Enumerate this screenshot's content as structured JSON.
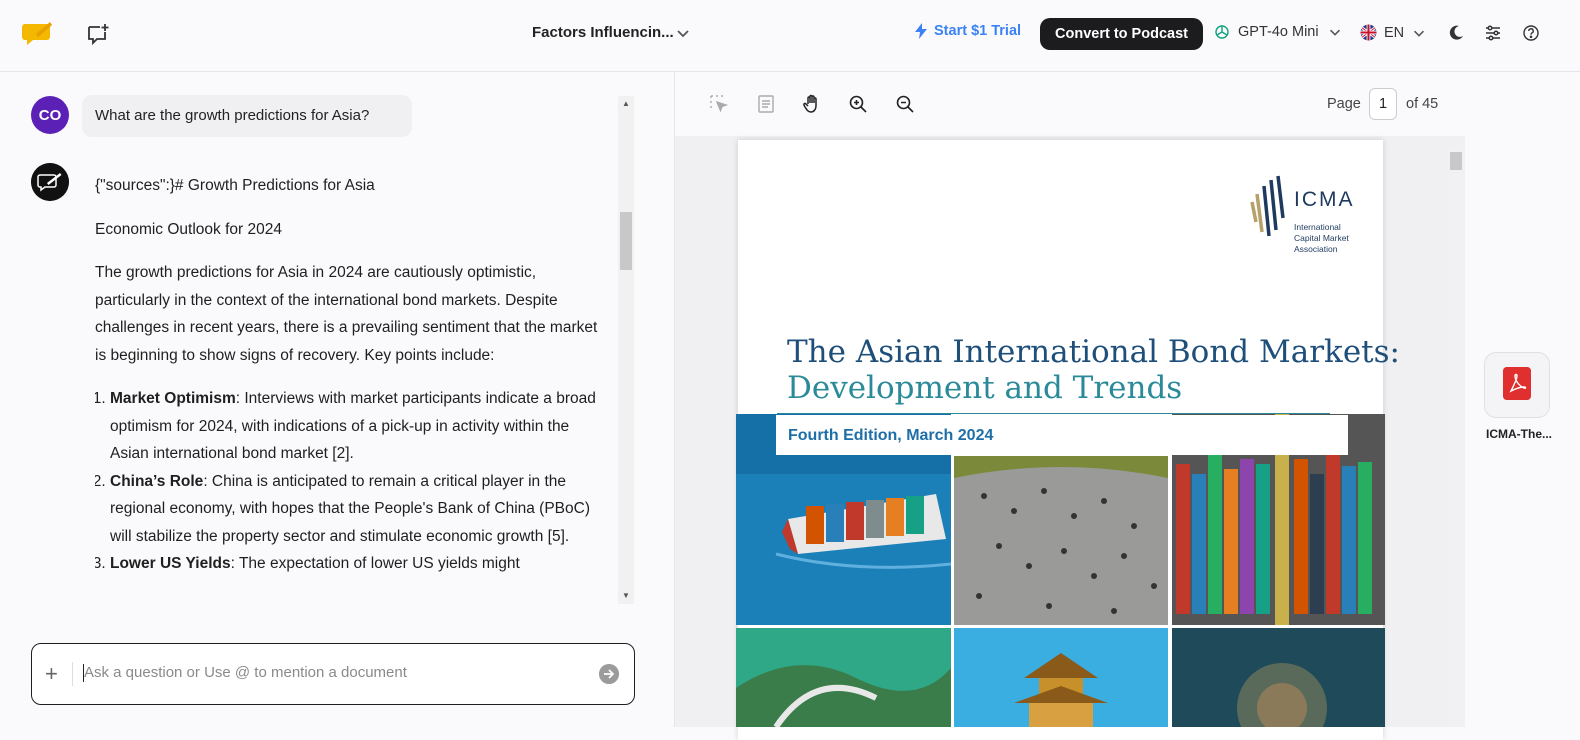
{
  "header": {
    "doc_title": "Factors Influencin...",
    "trial_label": "Start $1 Trial",
    "podcast_label": "Convert to Podcast",
    "model_label": "GPT-4o Mini",
    "lang_label": "EN"
  },
  "chat": {
    "user_initials": "CO",
    "user_question": "What are the growth predictions for Asia?",
    "answer_heading": "{\"sources\":}# Growth Predictions for Asia",
    "answer_subheading": "Economic Outlook for 2024",
    "answer_intro": "The growth predictions for Asia in 2024 are cautiously optimistic, particularly in the context of the international bond markets. Despite challenges in recent years, there is a prevailing sentiment that the market is beginning to show signs of recovery. Key points include:",
    "points": [
      {
        "title": "Market Optimism",
        "text": ": Interviews with market participants indicate a broad optimism for 2024, with indications of a pick-up in activity within the Asian international bond market [2]."
      },
      {
        "title": "China’s Role",
        "text": ": China is anticipated to remain a critical player in the regional economy, with hopes that the People's Bank of China (PBoC) will stabilize the property sector and stimulate economic growth [5]."
      },
      {
        "title": "Lower US Yields",
        "text": ": The expectation of lower US yields might"
      }
    ],
    "input_placeholder": "Ask a question or Use @ to mention a document"
  },
  "viewer": {
    "page_label": "Page",
    "page_current": "1",
    "page_total_label": "of 45"
  },
  "pdf": {
    "org_name": "ICMA",
    "org_sub": "International Capital Market Association",
    "title_line1": "The Asian International Bond Markets:",
    "title_line2": "Development and Trends",
    "edition": "Fourth Edition, March 2024"
  },
  "sidebar": {
    "file_name": "ICMA-The..."
  },
  "colors": {
    "accent": "#3b82f6",
    "podcast_bg": "#1c1c1e",
    "user_avatar": "#5b21b6",
    "pdf_title": "#1e4f7a",
    "pdf_teal": "#2a8a99"
  }
}
